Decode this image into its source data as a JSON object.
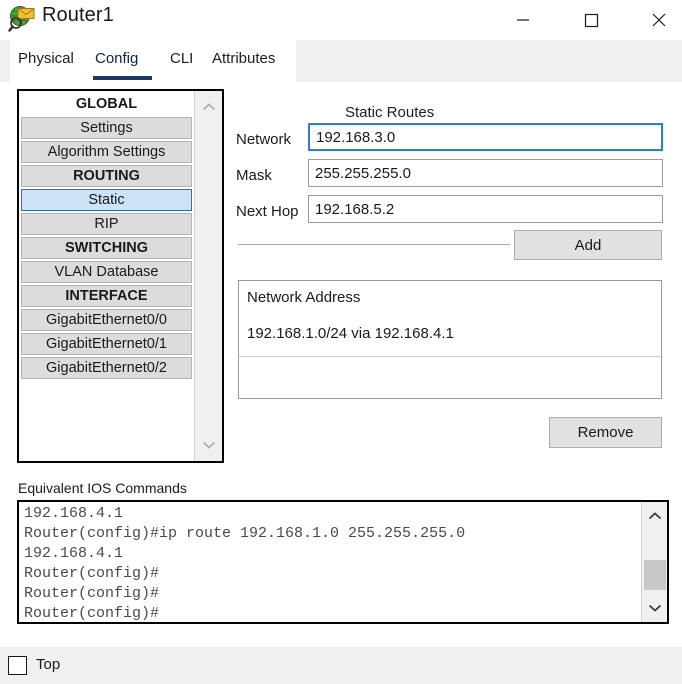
{
  "window": {
    "title": "Router1",
    "icon": "packet-tracer-router-icon",
    "controls": {
      "minimize": "minimize-icon",
      "maximize": "maximize-icon",
      "close": "close-icon"
    }
  },
  "tabs": [
    {
      "label": "Physical",
      "active": false
    },
    {
      "label": "Config",
      "active": true
    },
    {
      "label": "CLI",
      "active": false
    },
    {
      "label": "Attributes",
      "active": false
    }
  ],
  "sidebar": {
    "scroll_up_icon": "chevron-up-icon",
    "scroll_down_icon": "chevron-down-icon",
    "items": [
      {
        "label": "GLOBAL",
        "type": "header",
        "style": "plain",
        "selected": false
      },
      {
        "label": "Settings",
        "type": "item",
        "selected": false
      },
      {
        "label": "Algorithm Settings",
        "type": "item",
        "selected": false
      },
      {
        "label": "ROUTING",
        "type": "header",
        "selected": false
      },
      {
        "label": "Static",
        "type": "item",
        "selected": true
      },
      {
        "label": "RIP",
        "type": "item",
        "selected": false
      },
      {
        "label": "SWITCHING",
        "type": "header",
        "selected": false
      },
      {
        "label": "VLAN Database",
        "type": "item",
        "selected": false
      },
      {
        "label": "INTERFACE",
        "type": "header",
        "selected": false
      },
      {
        "label": "GigabitEthernet0/0",
        "type": "item",
        "selected": false
      },
      {
        "label": "GigabitEthernet0/1",
        "type": "item",
        "selected": false
      },
      {
        "label": "GigabitEthernet0/2",
        "type": "item",
        "selected": false
      }
    ]
  },
  "static_routes": {
    "title": "Static Routes",
    "fields": {
      "network_label": "Network",
      "network_value": "192.168.3.0",
      "mask_label": "Mask",
      "mask_value": "255.255.255.0",
      "next_hop_label": "Next Hop",
      "next_hop_value": "192.168.5.2"
    },
    "add_button": "Add",
    "remove_button": "Remove",
    "list": {
      "header": "Network Address",
      "rows": [
        "192.168.1.0/24 via 192.168.4.1"
      ]
    }
  },
  "ios_commands": {
    "label": "Equivalent IOS Commands",
    "text": "192.168.4.1\nRouter(config)#ip route 192.168.1.0 255.255.255.0\n192.168.4.1\nRouter(config)#\nRouter(config)#\nRouter(config)#",
    "scroll_up_icon": "chevron-up-icon",
    "scroll_down_icon": "chevron-down-icon"
  },
  "footer": {
    "top_checkbox_label": "Top",
    "top_checkbox_checked": false
  },
  "colors": {
    "accent": "#1f3864",
    "selection": "#cde3f7",
    "focus_border": "#2a7fd4",
    "panel": "#f0f0f0",
    "item": "#dcdcdc"
  }
}
